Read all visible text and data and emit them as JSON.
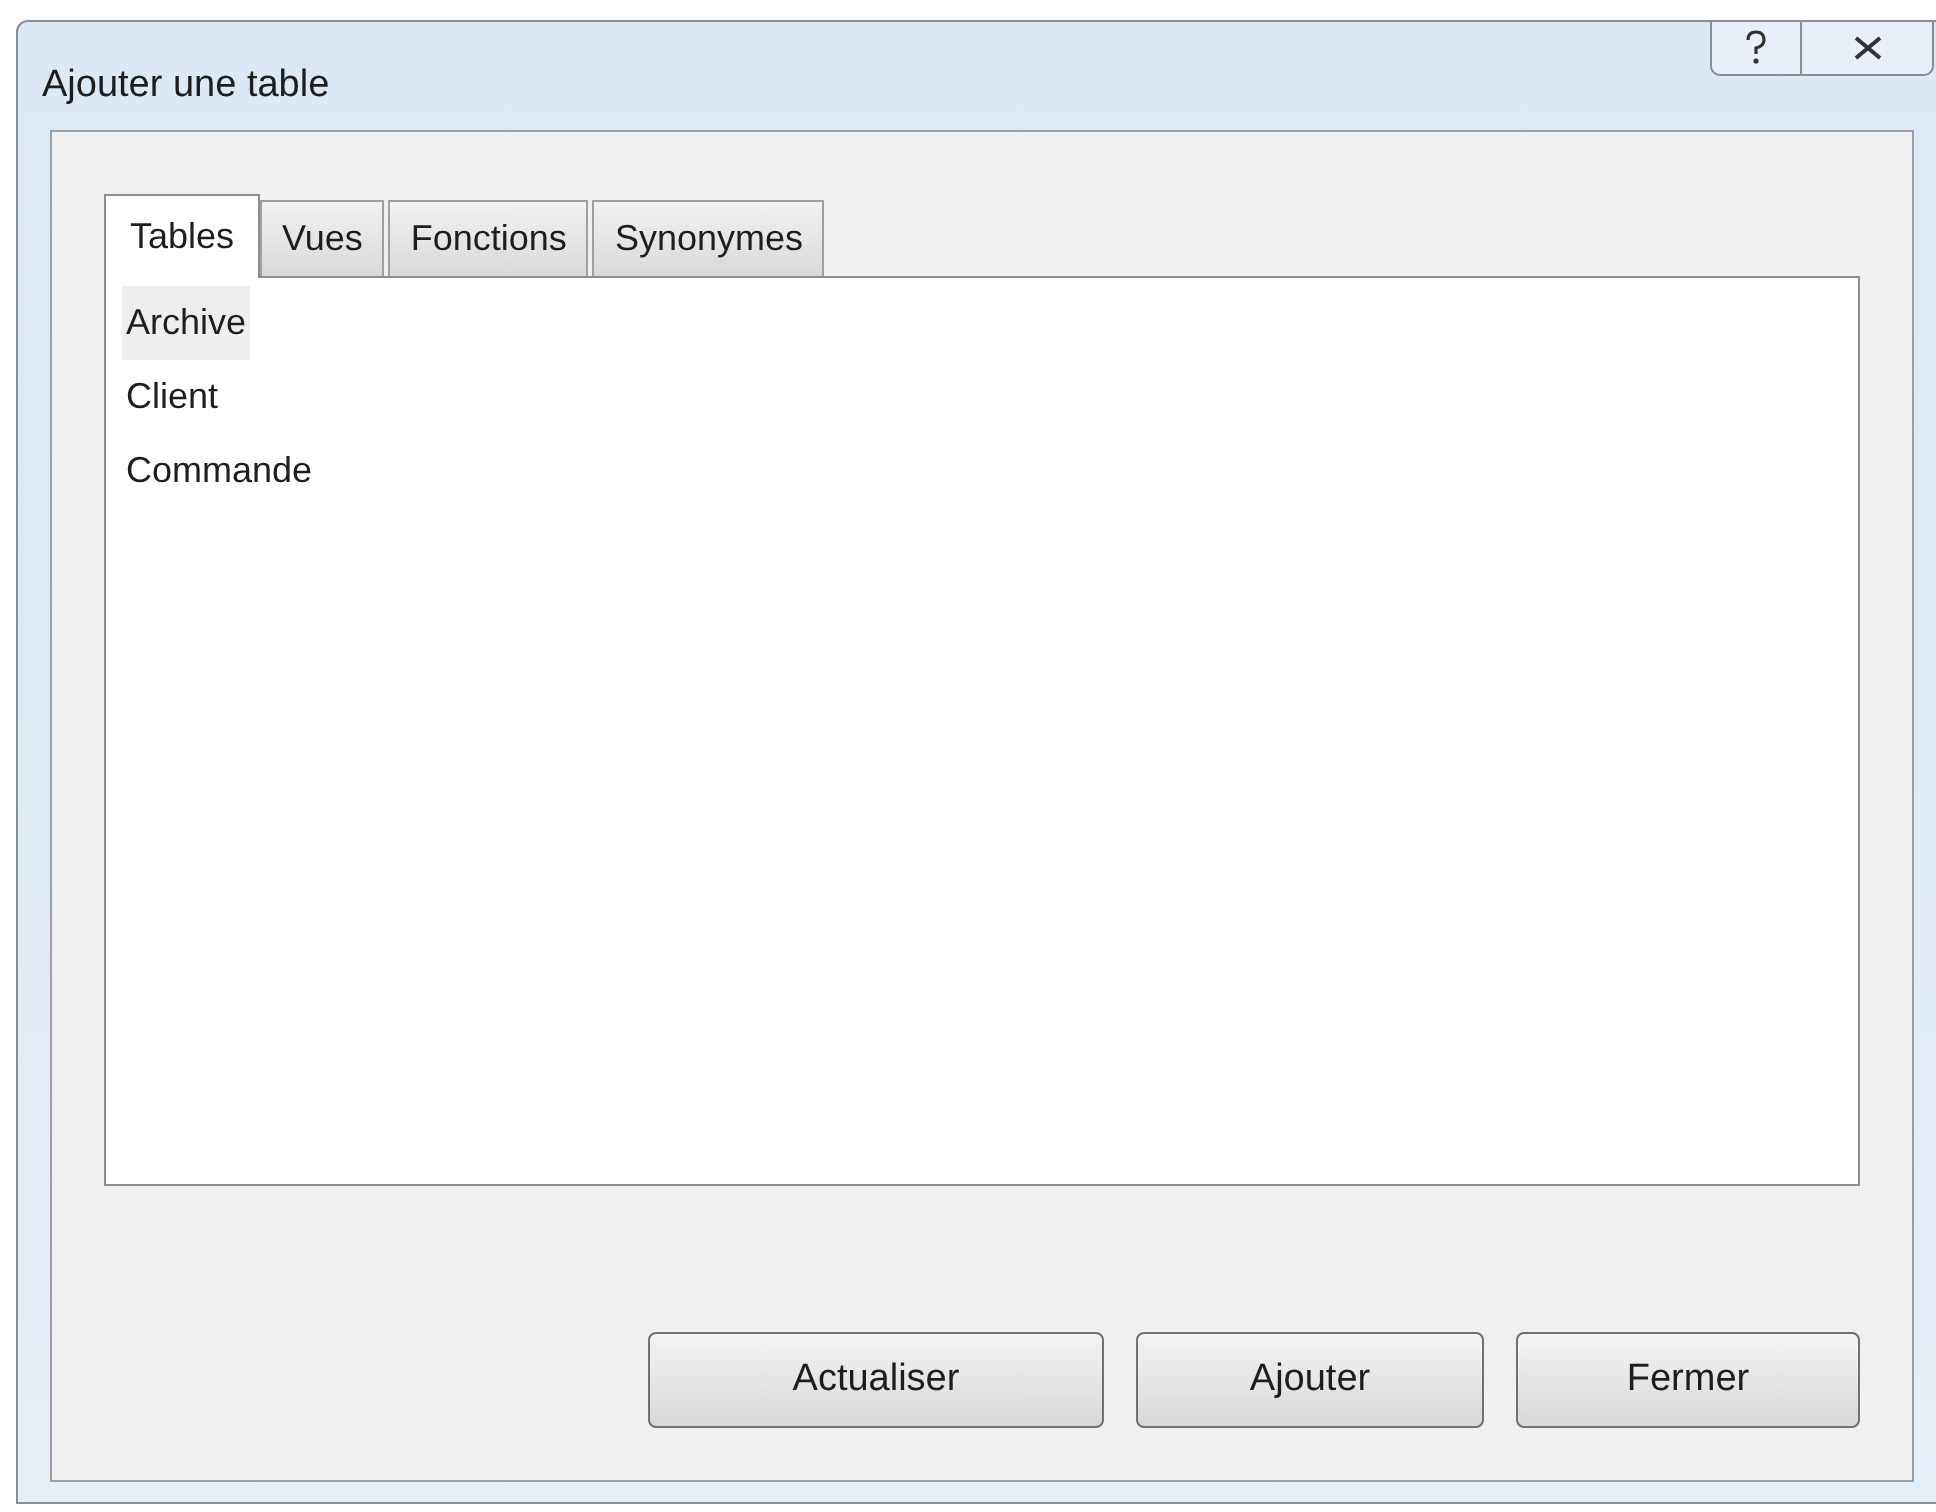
{
  "window": {
    "title": "Ajouter une table"
  },
  "tabs": [
    {
      "label": "Tables",
      "selected": true
    },
    {
      "label": "Vues",
      "selected": false
    },
    {
      "label": "Fonctions",
      "selected": false
    },
    {
      "label": "Synonymes",
      "selected": false
    }
  ],
  "list": {
    "items": [
      {
        "label": "Archive",
        "selected": true
      },
      {
        "label": "Client",
        "selected": false
      },
      {
        "label": "Commande",
        "selected": false
      }
    ]
  },
  "buttons": [
    "Actualiser",
    "Ajouter",
    "Fermer"
  ]
}
